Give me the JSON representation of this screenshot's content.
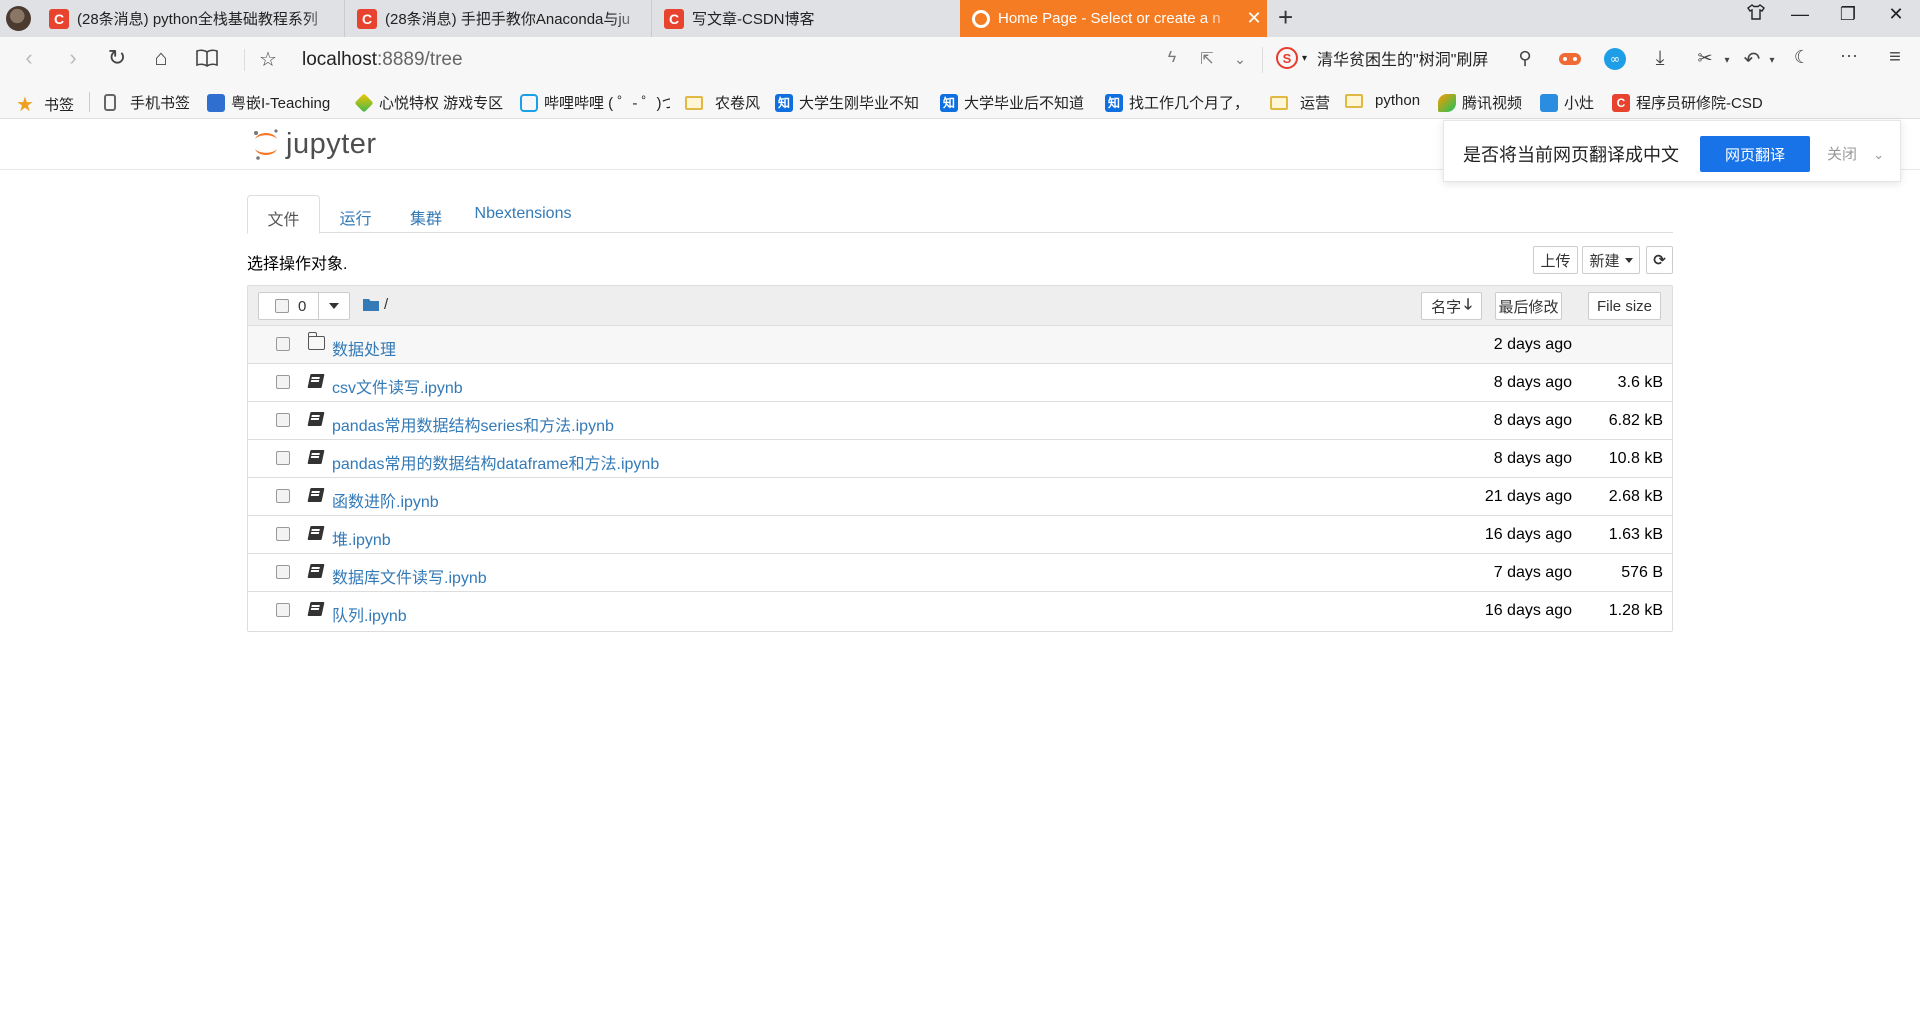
{
  "browser": {
    "tabs": [
      {
        "title": "(28条消息) python全栈基础教程系列",
        "favicon": "C"
      },
      {
        "title": "(28条消息) 手把手教你Anaconda与ju",
        "favicon": "C"
      },
      {
        "title": "写文章-CSDN博客",
        "favicon": "C"
      },
      {
        "title": "Home Page - Select or create a n",
        "favicon": "jupyter",
        "active": true
      }
    ],
    "url": {
      "host": "localhost",
      "rest": ":8889/tree"
    },
    "search_hint": "清华贫困生的\"树洞\"刷屏",
    "bookmarks": [
      {
        "label": "书签",
        "icon": "star-icon"
      },
      {
        "label": "手机书签",
        "icon": "phone-icon"
      },
      {
        "label": "粤嵌I-Teaching",
        "icon": "cube-icon"
      },
      {
        "label": "心悦特权 游戏专区",
        "icon": "diamond-icon"
      },
      {
        "label": "哔哩哔哩 ( ゜- ゜)つ",
        "icon": "bilibili-icon"
      },
      {
        "label": "农卷风",
        "icon": "folder-icon"
      },
      {
        "label": "大学生刚毕业不知",
        "icon": "zhihu-icon"
      },
      {
        "label": "大学毕业后不知道",
        "icon": "zhihu-icon"
      },
      {
        "label": "找工作几个月了，",
        "icon": "zhihu-icon"
      },
      {
        "label": "运营",
        "icon": "folder-icon"
      },
      {
        "label": "python",
        "icon": "folder-icon"
      },
      {
        "label": "腾讯视频",
        "icon": "tencent-video-icon"
      },
      {
        "label": "小灶",
        "icon": "bookmark-icon"
      },
      {
        "label": "程序员研修院-CSD",
        "icon": "csdn-icon"
      }
    ]
  },
  "translate": {
    "message": "是否将当前网页翻译成中文",
    "translate_button": "网页翻译",
    "close_label": "关闭"
  },
  "jupyter": {
    "logo_text": "jupyter",
    "tabs": [
      "文件",
      "运行",
      "集群",
      "Nbextensions"
    ],
    "select_hint": "选择操作对象.",
    "upload_label": "上传",
    "new_label": "新建",
    "selected_count": "0",
    "breadcrumb": "/",
    "sort_name": "名字",
    "sort_modified": "最后修改",
    "sort_size": "File size",
    "files": [
      {
        "name": "数据处理",
        "type": "folder",
        "modified": "2 days ago",
        "size": ""
      },
      {
        "name": "csv文件读写.ipynb",
        "type": "notebook",
        "modified": "8 days ago",
        "size": "3.6 kB"
      },
      {
        "name": "pandas常用数据结构series和方法.ipynb",
        "type": "notebook",
        "modified": "8 days ago",
        "size": "6.82 kB"
      },
      {
        "name": "pandas常用的数据结构dataframe和方法.ipynb",
        "type": "notebook",
        "modified": "8 days ago",
        "size": "10.8 kB"
      },
      {
        "name": "函数进阶.ipynb",
        "type": "notebook",
        "modified": "21 days ago",
        "size": "2.68 kB"
      },
      {
        "name": "堆.ipynb",
        "type": "notebook",
        "modified": "16 days ago",
        "size": "1.63 kB"
      },
      {
        "name": "数据库文件读写.ipynb",
        "type": "notebook",
        "modified": "7 days ago",
        "size": "576 B"
      },
      {
        "name": "队列.ipynb",
        "type": "notebook",
        "modified": "16 days ago",
        "size": "1.28 kB"
      }
    ]
  },
  "colors": {
    "accent_tab": "#f57c22",
    "link": "#337ab7",
    "translate_btn": "#1973e8",
    "csdn": "#e8432e"
  }
}
